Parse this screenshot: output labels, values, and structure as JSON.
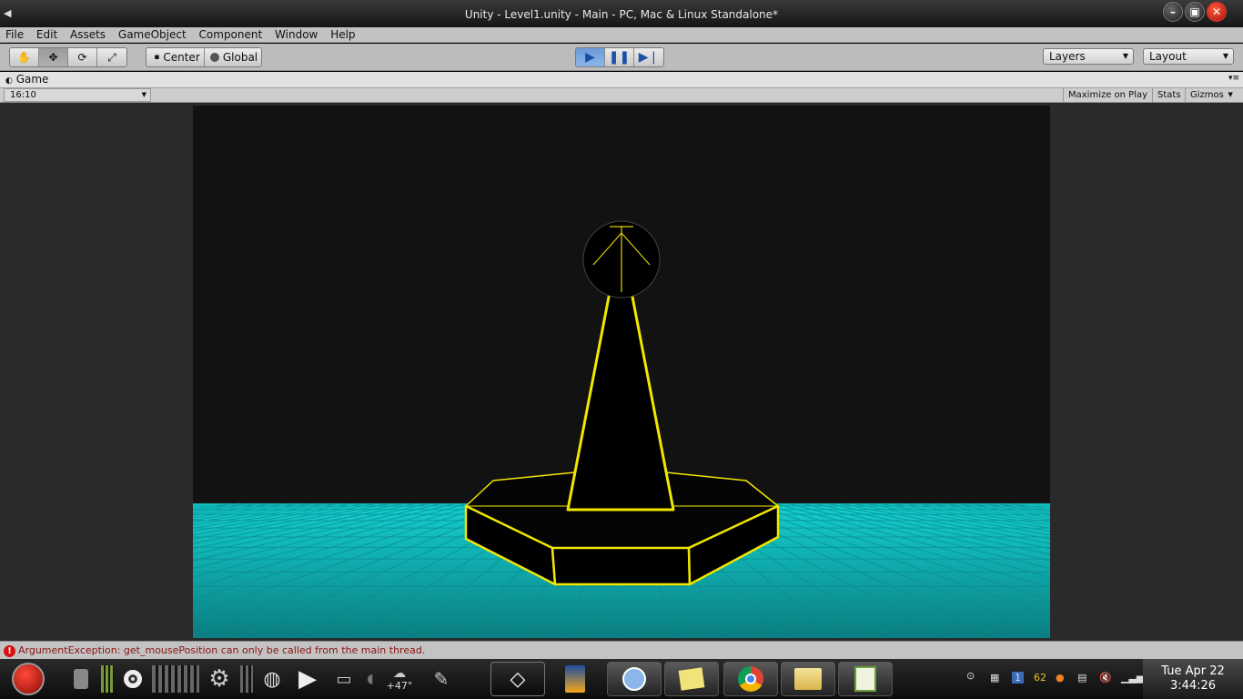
{
  "window": {
    "title": "Unity - Level1.unity - Main - PC, Mac & Linux Standalone*"
  },
  "menu": [
    "File",
    "Edit",
    "Assets",
    "GameObject",
    "Component",
    "Window",
    "Help"
  ],
  "toolbar": {
    "pivot_label": "Center",
    "space_label": "Global",
    "layers_label": "Layers",
    "layout_label": "Layout"
  },
  "game_view": {
    "tab_label": "Game",
    "aspect": "16:10",
    "maximize_label": "Maximize on Play",
    "stats_label": "Stats",
    "gizmos_label": "Gizmos"
  },
  "status": {
    "message": "ArgumentException: get_mousePosition can only be called from the main thread."
  },
  "taskbar": {
    "weather": "+47°",
    "tray_number_1": "1",
    "tray_number_62": "62",
    "clock_date": "Tue Apr 22",
    "clock_time": "3:44:26"
  },
  "colors": {
    "wire": "#f2e600",
    "floor": "#13c6c6",
    "sky": "#121212"
  }
}
